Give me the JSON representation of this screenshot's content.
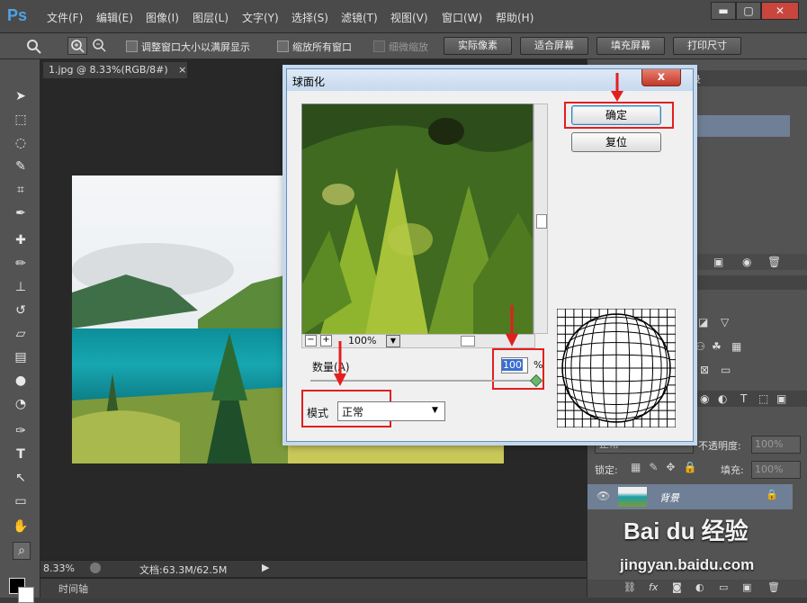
{
  "app": {
    "logo": "Ps"
  },
  "menu": {
    "items": [
      "文件(F)",
      "编辑(E)",
      "图像(I)",
      "图层(L)",
      "文字(Y)",
      "选择(S)",
      "滤镜(T)",
      "视图(V)",
      "窗口(W)",
      "帮助(H)"
    ]
  },
  "window_controls": {
    "minimize": "▬",
    "restore": "▢",
    "close": "✕"
  },
  "options_bar": {
    "resize_windows_label": "调整窗口大小以满屏显示",
    "zoom_all_label": "缩放所有窗口",
    "scrubby_zoom_label": "细微缩放",
    "actual_pixels": "实际像素",
    "fit_screen": "适合屏幕",
    "fill_screen": "填充屏幕",
    "print_size": "打印尺寸"
  },
  "document": {
    "tab_title": "1.jpg @ 8.33%(RGB/8#)",
    "tab_close": "×"
  },
  "status": {
    "zoom": "8.33%",
    "doc_info": "文档:63.3M/62.5M"
  },
  "timeline": {
    "label": "时间轴"
  },
  "dialog": {
    "title": "球面化",
    "close": "x",
    "ok": "确定",
    "reset": "复位",
    "preview_zoom": "100%",
    "zoom_minus": "−",
    "zoom_plus": "+",
    "amount_label": "数量(A)",
    "amount_value": "100",
    "amount_unit": "%",
    "mode_label": "模式",
    "mode_value": "正常"
  },
  "layers_panel": {
    "blend_mode": "正常",
    "opacity_label": "不透明度:",
    "opacity_value": "100%",
    "lock_label": "锁定:",
    "fill_label": "填充:",
    "fill_value": "100%",
    "layer_name": "背景"
  },
  "history_tab": {
    "label": "录"
  },
  "watermark": {
    "brand": "Bai du 经验",
    "url": "jingyan.baidu.com"
  },
  "colors": {
    "accent_red": "#e21f1f",
    "ps_blue": "#4fa3e6",
    "dialog_bg": "#f0f0f0"
  }
}
